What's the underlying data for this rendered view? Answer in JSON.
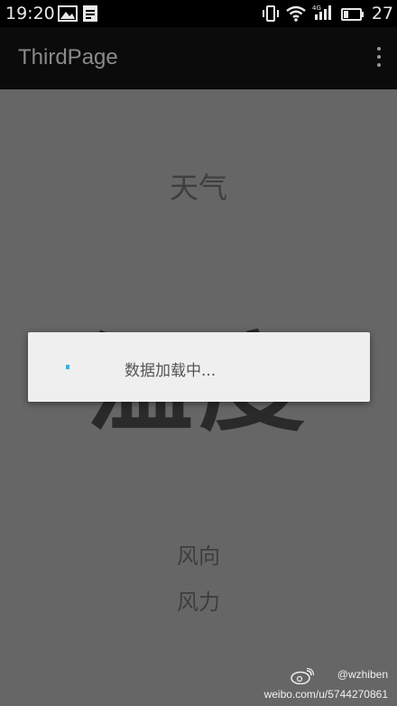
{
  "status_bar": {
    "time": "19:20",
    "battery_level": "27",
    "icons": [
      "image-icon",
      "notification-icon",
      "vibrate-icon",
      "wifi-icon",
      "signal-4g-icon",
      "battery-icon"
    ]
  },
  "action_bar": {
    "title": "ThirdPage",
    "menu_icon": "overflow-menu-icon"
  },
  "content": {
    "weather_label": "天气",
    "temperature_label": "温度",
    "wind_direction_label": "风向",
    "wind_force_label": "风力"
  },
  "dialog": {
    "message": "数据加载中...",
    "spinner_color": "#33b5e5"
  },
  "watermark": {
    "handle": "@wzhiben",
    "url": "weibo.com/u/5744270861"
  },
  "colors": {
    "dim_background": "#666666",
    "action_bar": "#0b0b0b",
    "dialog_background": "#efefef"
  }
}
